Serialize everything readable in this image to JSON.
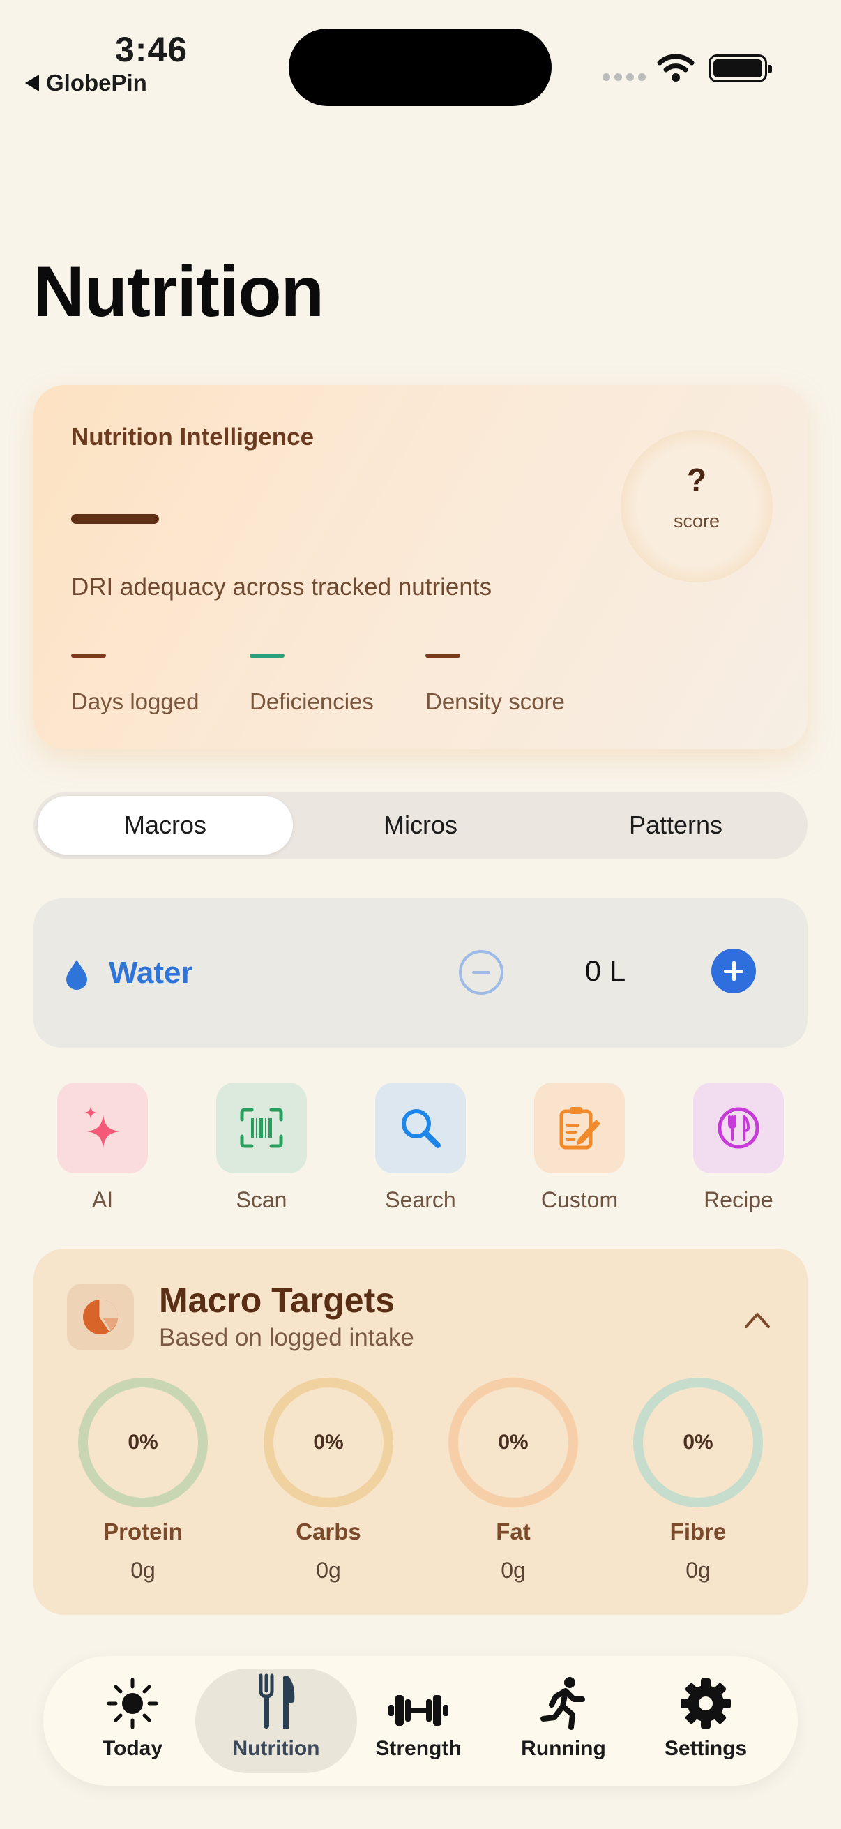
{
  "status_bar": {
    "time": "3:46",
    "back_app": "GlobePin"
  },
  "page": {
    "title": "Nutrition"
  },
  "intelligence": {
    "title": "Nutrition Intelligence",
    "subtitle": "DRI adequacy across tracked nutrients",
    "score_value": "?",
    "score_label": "score",
    "stats": [
      {
        "label": "Days logged",
        "color": "#7a3a1c"
      },
      {
        "label": "Deficiencies",
        "color": "#2aa07a"
      },
      {
        "label": "Density score",
        "color": "#7a3a1c"
      }
    ]
  },
  "segments": [
    "Macros",
    "Micros",
    "Patterns"
  ],
  "selected_segment": "Macros",
  "water": {
    "label": "Water",
    "value": "0 L"
  },
  "quick_actions": [
    {
      "label": "AI",
      "icon": "sparkles-icon",
      "color": "#f45a78"
    },
    {
      "label": "Scan",
      "icon": "barcode-scan-icon",
      "color": "#2a9e5e"
    },
    {
      "label": "Search",
      "icon": "search-icon",
      "color": "#1d86e8"
    },
    {
      "label": "Custom",
      "icon": "edit-note-icon",
      "color": "#f08a2a"
    },
    {
      "label": "Recipe",
      "icon": "fork-knife-circle-icon",
      "color": "#c63ad8"
    }
  ],
  "macro_targets": {
    "title": "Macro Targets",
    "subtitle": "Based on logged intake",
    "items": [
      {
        "name": "Protein",
        "percent": "0%",
        "amount": "0g",
        "color": "#c8d6b3"
      },
      {
        "name": "Carbs",
        "percent": "0%",
        "amount": "0g",
        "color": "#efd29f"
      },
      {
        "name": "Fat",
        "percent": "0%",
        "amount": "0g",
        "color": "#f6cfa8"
      },
      {
        "name": "Fibre",
        "percent": "0%",
        "amount": "0g",
        "color": "#c6dccc"
      }
    ]
  },
  "tabs": [
    {
      "label": "Today",
      "icon": "sun-icon"
    },
    {
      "label": "Nutrition",
      "icon": "fork-knife-icon"
    },
    {
      "label": "Strength",
      "icon": "dumbbell-icon"
    },
    {
      "label": "Running",
      "icon": "runner-icon"
    },
    {
      "label": "Settings",
      "icon": "gear-icon"
    }
  ],
  "selected_tab": "Nutrition"
}
